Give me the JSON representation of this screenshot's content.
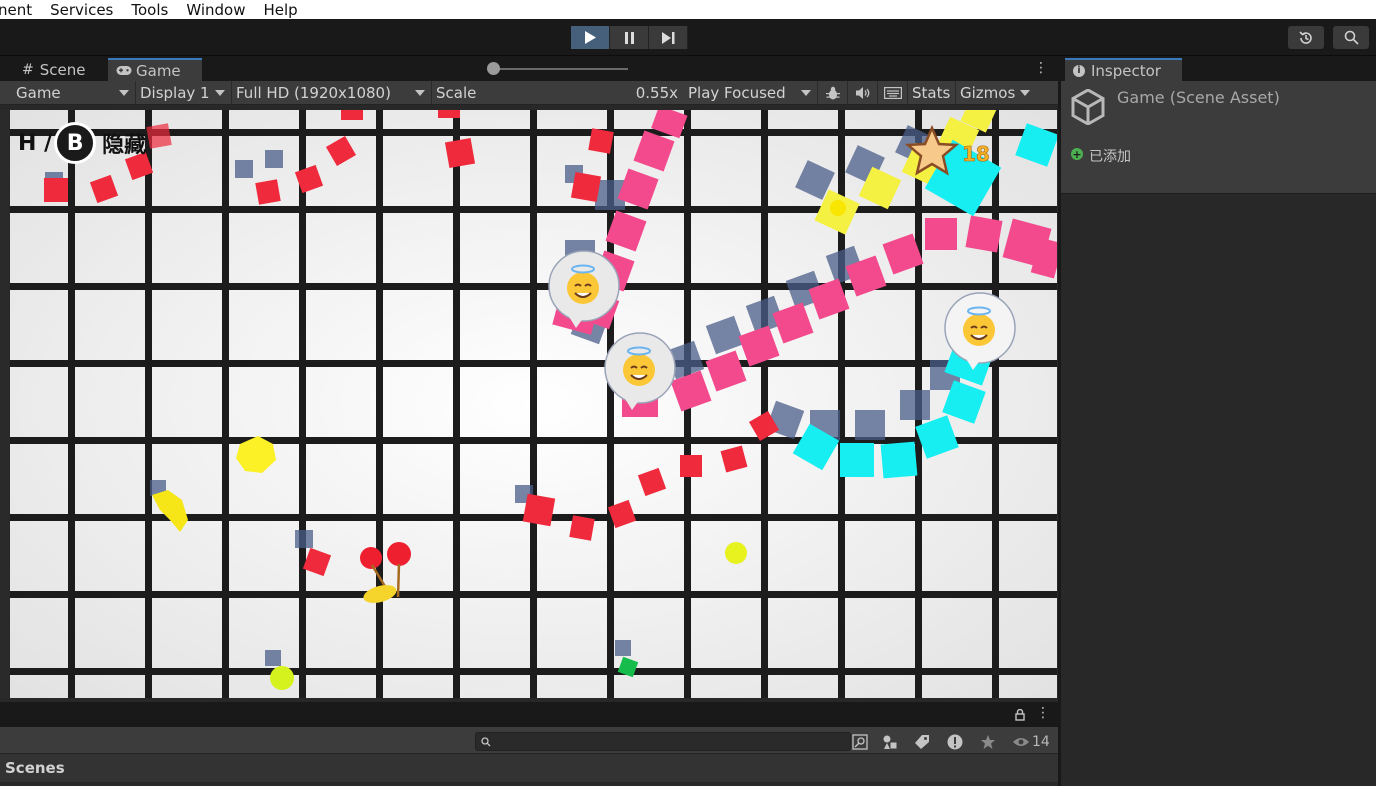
{
  "menu": [
    "nent",
    "Services",
    "Tools",
    "Window",
    "Help"
  ],
  "panel_tabs": {
    "scene": "Scene",
    "game": "Game"
  },
  "game_bar": {
    "display_mode": "Game",
    "display": "Display 1",
    "resolution": "Full HD (1920x1080)",
    "scale_label": "Scale",
    "scale_value": "0.55x",
    "play_mode": "Play Focused",
    "stats": "Stats",
    "gizmos": "Gizmos"
  },
  "hud": {
    "prefix": "H /",
    "key": "B",
    "label": "隐藏"
  },
  "score": "18",
  "inspector": {
    "tab": "Inspector",
    "title": "Game (Scene Asset)",
    "added": "已添加"
  },
  "bottom": {
    "count": "14",
    "scenes": "Scenes"
  },
  "colors": {
    "accent": "#3a79bb",
    "play_active": "#46607c",
    "add_green": "#4caf50"
  }
}
